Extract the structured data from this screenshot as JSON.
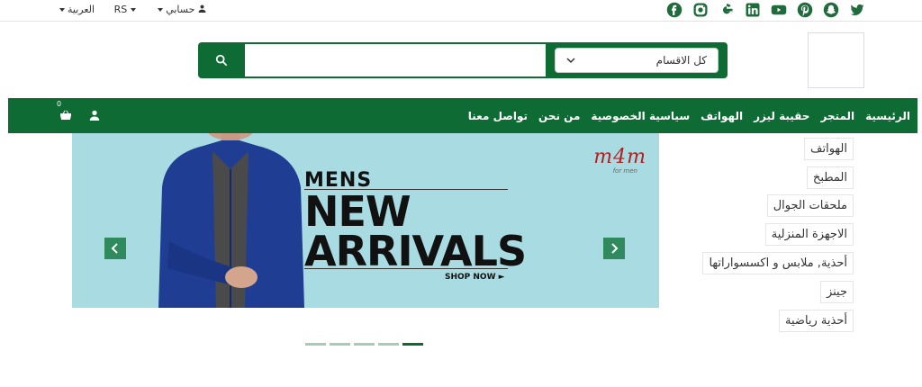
{
  "topbar": {
    "language": "العربية",
    "currency": "RS",
    "account": "حسابي",
    "socials": [
      "twitter-icon",
      "snapchat-icon",
      "pinterest-icon",
      "youtube-icon",
      "linkedin-icon",
      "google-icon",
      "instagram-icon",
      "facebook-icon"
    ]
  },
  "search": {
    "placeholder": "",
    "category": "كل الاقسام"
  },
  "nav": {
    "items": [
      "الرئيسية",
      "المتجر",
      "حقيبة ليزر",
      "الهواتف",
      "سياسية الخصوصية",
      "من نحن",
      "تواصل معنا"
    ],
    "cart_count": "0"
  },
  "banner": {
    "brand": "m4m",
    "brand_sub": "for men",
    "headline1": "MENS",
    "headline2": "NEW",
    "headline3": "ARRIVALS",
    "cta": "SHOP NOW ►"
  },
  "categories": [
    "الهواتف",
    "المطبخ",
    "ملحقات الجوال",
    "الاجهزة المنزلية",
    "أحذية, ملابس و اكسسواراتها",
    "جينز",
    "أحذية رياضية"
  ],
  "carousel": {
    "slides": 5,
    "active": 5
  },
  "colors": {
    "primary": "#0e6b34",
    "banner_bg": "#a8dbe2"
  }
}
